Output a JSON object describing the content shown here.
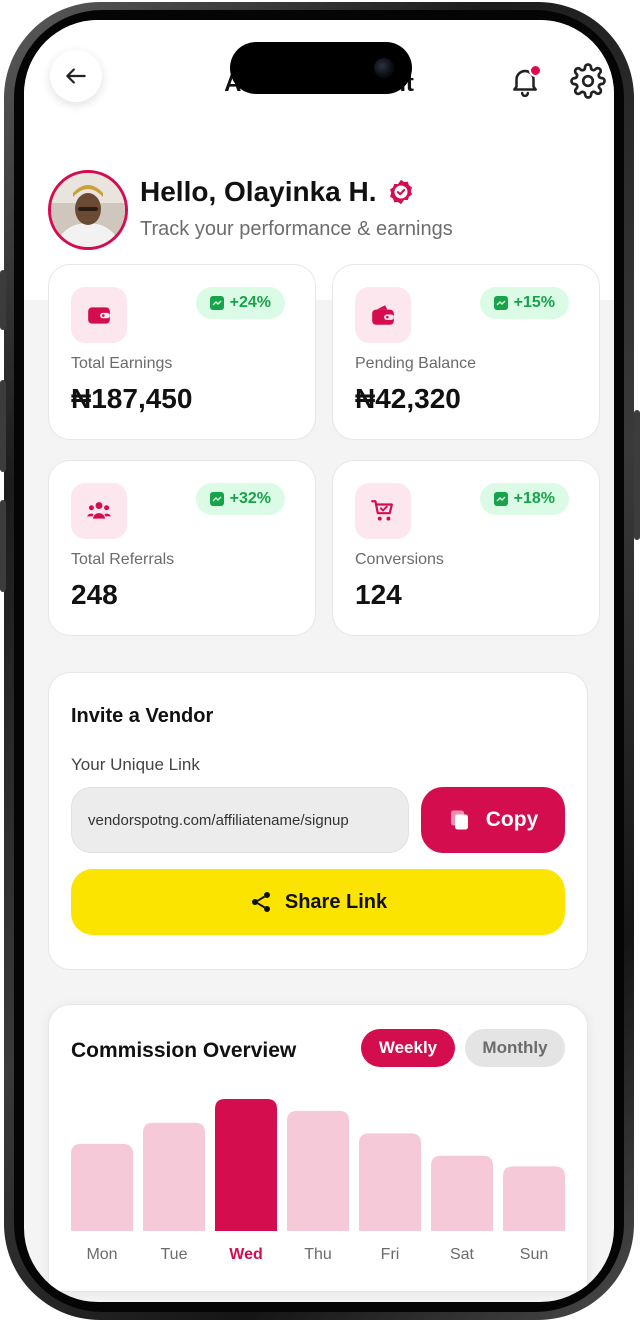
{
  "header": {
    "title": "Affiliate Account",
    "notification_dot": true
  },
  "profile": {
    "greeting": "Hello, Olayinka H.",
    "subtitle": "Track your performance & earnings",
    "verified": true
  },
  "stats": [
    {
      "label": "Total Earnings",
      "value": "₦187,450",
      "change": "+24%",
      "icon": "wallet-icon"
    },
    {
      "label": "Pending Balance",
      "value": "₦42,320",
      "change": "+15%",
      "icon": "purse-icon"
    },
    {
      "label": "Total Referrals",
      "value": "248",
      "change": "+32%",
      "icon": "users-icon"
    },
    {
      "label": "Conversions",
      "value": "124",
      "change": "+18%",
      "icon": "cart-icon"
    }
  ],
  "invite": {
    "title": "Invite a Vendor",
    "link_label": "Your Unique Link",
    "link_value": "vendorspotng.com/affiliatename/signup",
    "copy_label": "Copy",
    "share_label": "Share Link"
  },
  "commission": {
    "title": "Commission Overview",
    "tabs": {
      "weekly": "Weekly",
      "monthly": "Monthly"
    },
    "active_tab": "Weekly"
  },
  "colors": {
    "accent": "#d40d4f",
    "accent_light": "#f5c9d7",
    "share_yellow": "#fbe400",
    "positive_green": "#16a34a"
  },
  "chart_data": {
    "type": "bar",
    "categories": [
      "Mon",
      "Tue",
      "Wed",
      "Thu",
      "Fri",
      "Sat",
      "Sun"
    ],
    "values": [
      66,
      82,
      100,
      91,
      74,
      57,
      49
    ],
    "highlighted": "Wed",
    "title": "",
    "ylim": [
      0,
      100
    ]
  }
}
